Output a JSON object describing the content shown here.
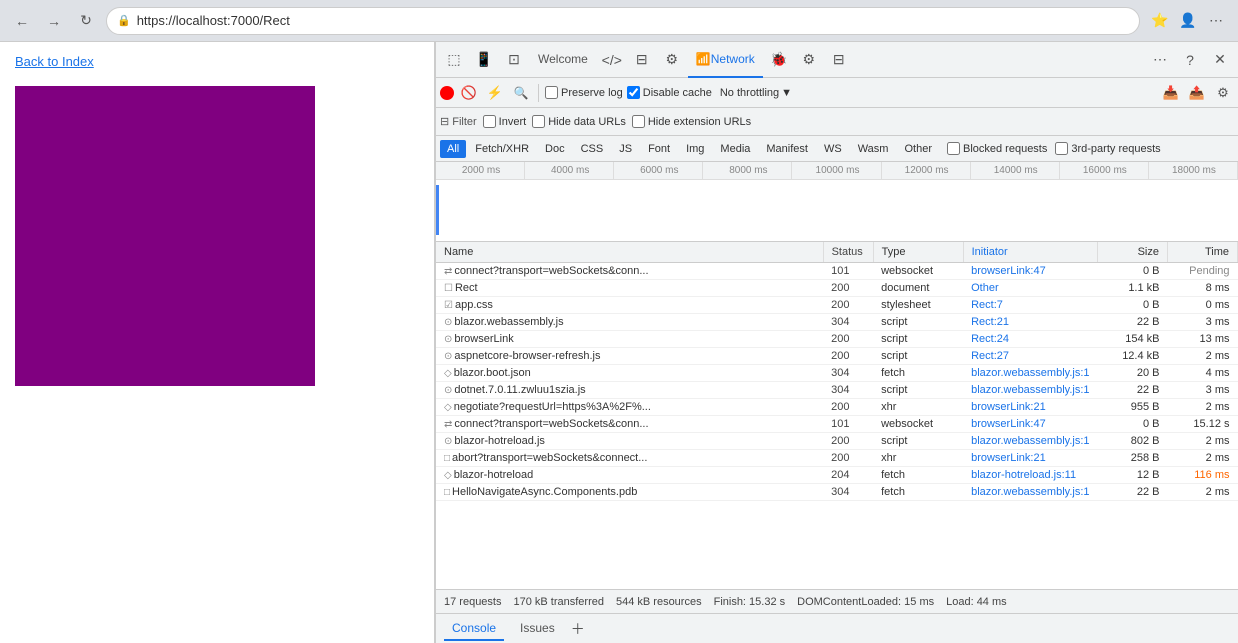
{
  "browser": {
    "url": "https://localhost:7000/Rect",
    "back_label": "←",
    "refresh_label": "↻"
  },
  "page": {
    "back_link": "Back to Index"
  },
  "devtools": {
    "tabs": [
      {
        "id": "elements",
        "icon": "⬚",
        "label": ""
      },
      {
        "id": "console",
        "icon": "≡",
        "label": ""
      },
      {
        "id": "sources",
        "icon": "⊡",
        "label": ""
      },
      {
        "id": "network",
        "label": "Network"
      },
      {
        "id": "performance",
        "icon": "⌛",
        "label": ""
      },
      {
        "id": "memory",
        "icon": "◎",
        "label": ""
      },
      {
        "id": "application",
        "icon": "⊟",
        "label": ""
      },
      {
        "id": "security",
        "icon": "🔒",
        "label": ""
      },
      {
        "id": "lighthouse",
        "icon": "◈",
        "label": ""
      }
    ],
    "welcome_tab": "Welcome",
    "network_tab": "Network"
  },
  "network": {
    "toolbar": {
      "preserve_log": "Preserve log",
      "disable_cache": "Disable cache",
      "throttling": "No throttling"
    },
    "filter": {
      "filter_label": "Filter",
      "invert": "Invert",
      "hide_data_urls": "Hide data URLs",
      "hide_extension_urls": "Hide extension URLs"
    },
    "type_filters": [
      "All",
      "Fetch/XHR",
      "Doc",
      "CSS",
      "JS",
      "Font",
      "Img",
      "Media",
      "Manifest",
      "WS",
      "Wasm",
      "Other"
    ],
    "active_type": "All",
    "blocked_requests": "Blocked requests",
    "third_party": "3rd-party requests",
    "timeline_ticks": [
      "2000 ms",
      "4000 ms",
      "6000 ms",
      "8000 ms",
      "10000 ms",
      "12000 ms",
      "14000 ms",
      "16000 ms",
      "18000 ms"
    ],
    "table_headers": [
      "Name",
      "Status",
      "Type",
      "Initiator",
      "Size",
      "Time"
    ],
    "rows": [
      {
        "name": "connect?transport=webSockets&conn...",
        "icon": "⇄",
        "status": "101",
        "type": "websocket",
        "initiator": "browserLink:47",
        "initiator_link": true,
        "size": "0 B",
        "time": "Pending",
        "pending": true
      },
      {
        "name": "Rect",
        "icon": "☐",
        "status": "200",
        "type": "document",
        "initiator": "Other",
        "initiator_link": false,
        "size": "1.1 kB",
        "time": "8 ms",
        "pending": false
      },
      {
        "name": "app.css",
        "icon": "☑",
        "status": "200",
        "type": "stylesheet",
        "initiator": "Rect:7",
        "initiator_link": true,
        "size": "0 B",
        "time": "0 ms",
        "pending": false
      },
      {
        "name": "blazor.webassembly.js",
        "icon": "⊙",
        "status": "304",
        "type": "script",
        "initiator": "Rect:21",
        "initiator_link": true,
        "size": "22 B",
        "time": "3 ms",
        "pending": false
      },
      {
        "name": "browserLink",
        "icon": "⊙",
        "status": "200",
        "type": "script",
        "initiator": "Rect:24",
        "initiator_link": true,
        "size": "154 kB",
        "time": "13 ms",
        "pending": false
      },
      {
        "name": "aspnetcore-browser-refresh.js",
        "icon": "⊙",
        "status": "200",
        "type": "script",
        "initiator": "Rect:27",
        "initiator_link": true,
        "size": "12.4 kB",
        "time": "2 ms",
        "pending": false
      },
      {
        "name": "blazor.boot.json",
        "icon": "◇",
        "status": "304",
        "type": "fetch",
        "initiator": "blazor.webassembly.js:1",
        "initiator_link": true,
        "size": "20 B",
        "time": "4 ms",
        "pending": false
      },
      {
        "name": "dotnet.7.0.11.zwluu1szia.js",
        "icon": "⊙",
        "status": "304",
        "type": "script",
        "initiator": "blazor.webassembly.js:1",
        "initiator_link": true,
        "size": "22 B",
        "time": "3 ms",
        "pending": false
      },
      {
        "name": "negotiate?requestUrl=https%3A%2F%...",
        "icon": "◇",
        "status": "200",
        "type": "xhr",
        "initiator": "browserLink:21",
        "initiator_link": true,
        "size": "955 B",
        "time": "2 ms",
        "pending": false
      },
      {
        "name": "connect?transport=webSockets&conn...",
        "icon": "⇄",
        "status": "101",
        "type": "websocket",
        "initiator": "browserLink:47",
        "initiator_link": true,
        "size": "0 B",
        "time": "15.12 s",
        "pending": false
      },
      {
        "name": "blazor-hotreload.js",
        "icon": "⊙",
        "status": "200",
        "type": "script",
        "initiator": "blazor.webassembly.js:1",
        "initiator_link": true,
        "size": "802 B",
        "time": "2 ms",
        "pending": false
      },
      {
        "name": "abort?transport=webSockets&connect...",
        "icon": "□",
        "status": "200",
        "type": "xhr",
        "initiator": "browserLink:21",
        "initiator_link": true,
        "size": "258 B",
        "time": "2 ms",
        "pending": false
      },
      {
        "name": "blazor-hotreload",
        "icon": "◇",
        "status": "204",
        "type": "fetch",
        "initiator": "blazor-hotreload.js:11",
        "initiator_link": true,
        "size": "12 B",
        "time": "116 ms",
        "time_highlight": true,
        "pending": false
      },
      {
        "name": "HelloNavigateAsync.Components.pdb",
        "icon": "□",
        "status": "304",
        "type": "fetch",
        "initiator": "blazor.webassembly.js:1",
        "initiator_link": true,
        "size": "22 B",
        "time": "2 ms",
        "pending": false
      }
    ],
    "status_bar": {
      "requests": "17 requests",
      "transferred": "170 kB transferred",
      "resources": "544 kB resources",
      "finish": "Finish: 15.32 s",
      "dom_content_loaded": "DOMContentLoaded: 15 ms",
      "load": "Load: 44 ms"
    },
    "bottom_tabs": [
      "Console",
      "Issues"
    ]
  }
}
